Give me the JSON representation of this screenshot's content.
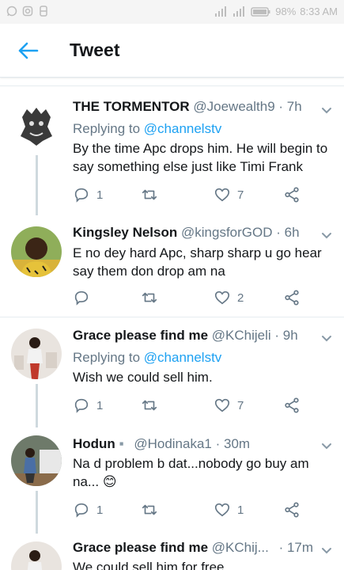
{
  "status_bar": {
    "battery": "98%",
    "time": "8:33 AM"
  },
  "header": {
    "title": "Tweet"
  },
  "tweets": [
    {
      "name": "THE TORMENTOR",
      "handle": "@Joewealth9",
      "time": "· 7h",
      "replying_prefix": "Replying to ",
      "replying_to": "@channelstv",
      "text": "By the time Apc drops him. He will begin to say something else just like Timi Frank",
      "replies": "1",
      "retweets": "",
      "likes": "7"
    },
    {
      "name": "Kingsley Nelson",
      "handle": "@kingsforGOD",
      "time": "· 6h",
      "replying_prefix": "",
      "replying_to": "",
      "text": "E no dey hard Apc, sharp sharp u go hear say them don drop am na",
      "replies": "",
      "retweets": "",
      "likes": "2"
    },
    {
      "name": "Grace please find me",
      "handle": "@KChijeli",
      "time": "· 9h",
      "replying_prefix": "Replying to ",
      "replying_to": "@channelstv",
      "text": "Wish we could sell him.",
      "replies": "1",
      "retweets": "",
      "likes": "7"
    },
    {
      "name": "Hodun",
      "handle": "@Hodinaka1",
      "time": "· 30m",
      "replying_prefix": "",
      "replying_to": "",
      "text": "Na d problem b dat...nobody go buy am na...",
      "emoji": "😊",
      "replies": "1",
      "retweets": "",
      "likes": "1"
    },
    {
      "name": "Grace please find me",
      "handle": "@KChij...",
      "time": "· 17m",
      "text": "We could sell him for free"
    }
  ],
  "colors": {
    "accent": "#1da1f2",
    "muted": "#657786",
    "text": "#14171a",
    "divider": "#e6ecf0"
  }
}
